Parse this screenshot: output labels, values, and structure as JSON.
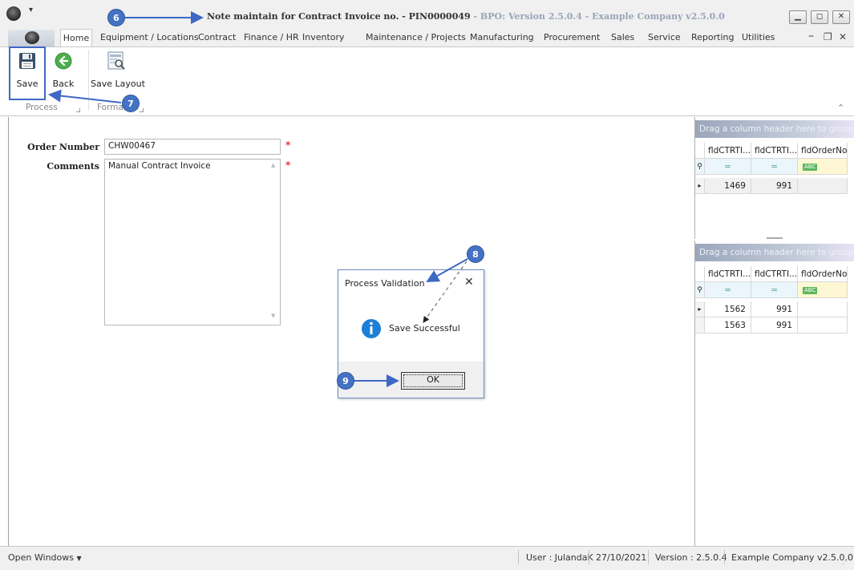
{
  "window": {
    "title": "Note maintain for Contract Invoice no. - PIN0000049",
    "title_suffix": " - BPO: Version 2.5.0.4 - Example Company v2.5.0.0",
    "buttons": [
      "minimize",
      "restore",
      "close"
    ]
  },
  "menu": {
    "items": [
      "Home",
      "Equipment / Locations",
      "Contract",
      "Finance / HR",
      "Inventory",
      "Maintenance / Projects",
      "Manufacturing",
      "Procurement",
      "Sales",
      "Service",
      "Reporting",
      "Utilities"
    ],
    "active": "Home"
  },
  "ribbon": {
    "process_group": {
      "label": "Process",
      "buttons": [
        {
          "label": "Save",
          "icon": "floppy-disk-icon"
        },
        {
          "label": "Back",
          "icon": "back-arrow-icon"
        }
      ]
    },
    "format_group": {
      "label": "Format",
      "buttons": [
        {
          "label": "Save Layout",
          "icon": "save-layout-icon"
        }
      ]
    }
  },
  "form": {
    "order_number_label": "Order Number",
    "order_number_value": "CHW00467",
    "comments_label": "Comments",
    "comments_value": "Manual Contract Invoice",
    "required_mark": "*"
  },
  "grid_top": {
    "group_hint": "Drag a column header here to group by that column",
    "columns": [
      "fldCTRTI...",
      "fldCTRTI...",
      "fldOrderNo"
    ],
    "filter_symbol": "=",
    "abc_tag": "ABC",
    "rows": [
      [
        "1469",
        "991",
        ""
      ]
    ]
  },
  "grid_bottom": {
    "group_hint": "Drag a column header here to group by that column",
    "columns": [
      "fldCTRTI...",
      "fldCTRTI...",
      "fldOrderNo"
    ],
    "filter_symbol": "=",
    "abc_tag": "ABC",
    "rows": [
      [
        "1562",
        "991",
        ""
      ],
      [
        "1563",
        "991",
        ""
      ]
    ]
  },
  "dialog": {
    "title": "Process Validation",
    "message": "Save Successful",
    "ok_label": "OK",
    "icon": "info-icon"
  },
  "statusbar": {
    "open_windows": "Open Windows",
    "user": "User : JulandaK",
    "date": "27/10/2021",
    "version": "Version : 2.5.0.4",
    "company": "Example Company v2.5.0.0"
  },
  "annotations": [
    "6",
    "7",
    "8",
    "9"
  ],
  "colors": {
    "accent": "#4472c4",
    "required": "#e33333",
    "info": "#1e7fd6"
  }
}
